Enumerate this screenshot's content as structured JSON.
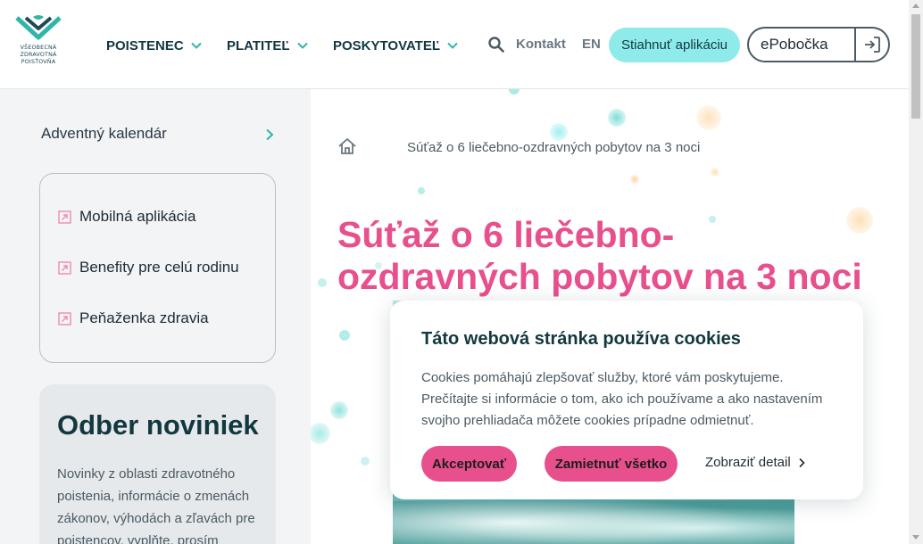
{
  "logo": {
    "line1": "VŠEOBECNÁ",
    "line2": "ZDRAVOTNÁ",
    "line3": "POISŤOVŇA"
  },
  "nav": {
    "items": [
      {
        "label": "POISTENEC"
      },
      {
        "label": "PLATITEĽ"
      },
      {
        "label": "POSKYTOVATEĽ"
      }
    ],
    "kontakt": "Kontakt",
    "lang": "EN",
    "app_button": "Stiahnuť aplikáciu",
    "epobocka": "ePobočka"
  },
  "sidebar": {
    "advent": "Adventný kalendár",
    "links": [
      {
        "label": "Mobilná aplikácia"
      },
      {
        "label": "Benefity pre celú rodinu"
      },
      {
        "label": "Peňaženka zdravia"
      }
    ],
    "newsletter": {
      "title": "Odber noviniek",
      "body": "Novinky z oblasti zdravotného poistenia, informácie o zmenách zákonov, výhodách a zľavách pre poistencov, vyplňte, prosím"
    }
  },
  "main": {
    "breadcrumb": "Súťaž o 6 liečebno-ozdravných pobytov na 3 noci",
    "title_line1": "Súťaž o 6 liečebno-",
    "title_line2": "ozdravných pobytov na 3 noci"
  },
  "cookie": {
    "title": "Táto webová stránka používa cookies",
    "text": "Cookies pomáhajú zlepšovať služby, ktoré vám poskytujeme. Prečítajte si informácie o tom, ako ich používame a ako nastavením svojho prehliadača môžete cookies prípadne odmietnuť.",
    "accept": "Akceptovať",
    "reject": "Zamietnuť všetko",
    "detail": "Zobraziť detail"
  },
  "colors": {
    "brand_teal": "#12383f",
    "accent_pink": "#e84f8d",
    "app_button_bg": "#8eebea"
  }
}
